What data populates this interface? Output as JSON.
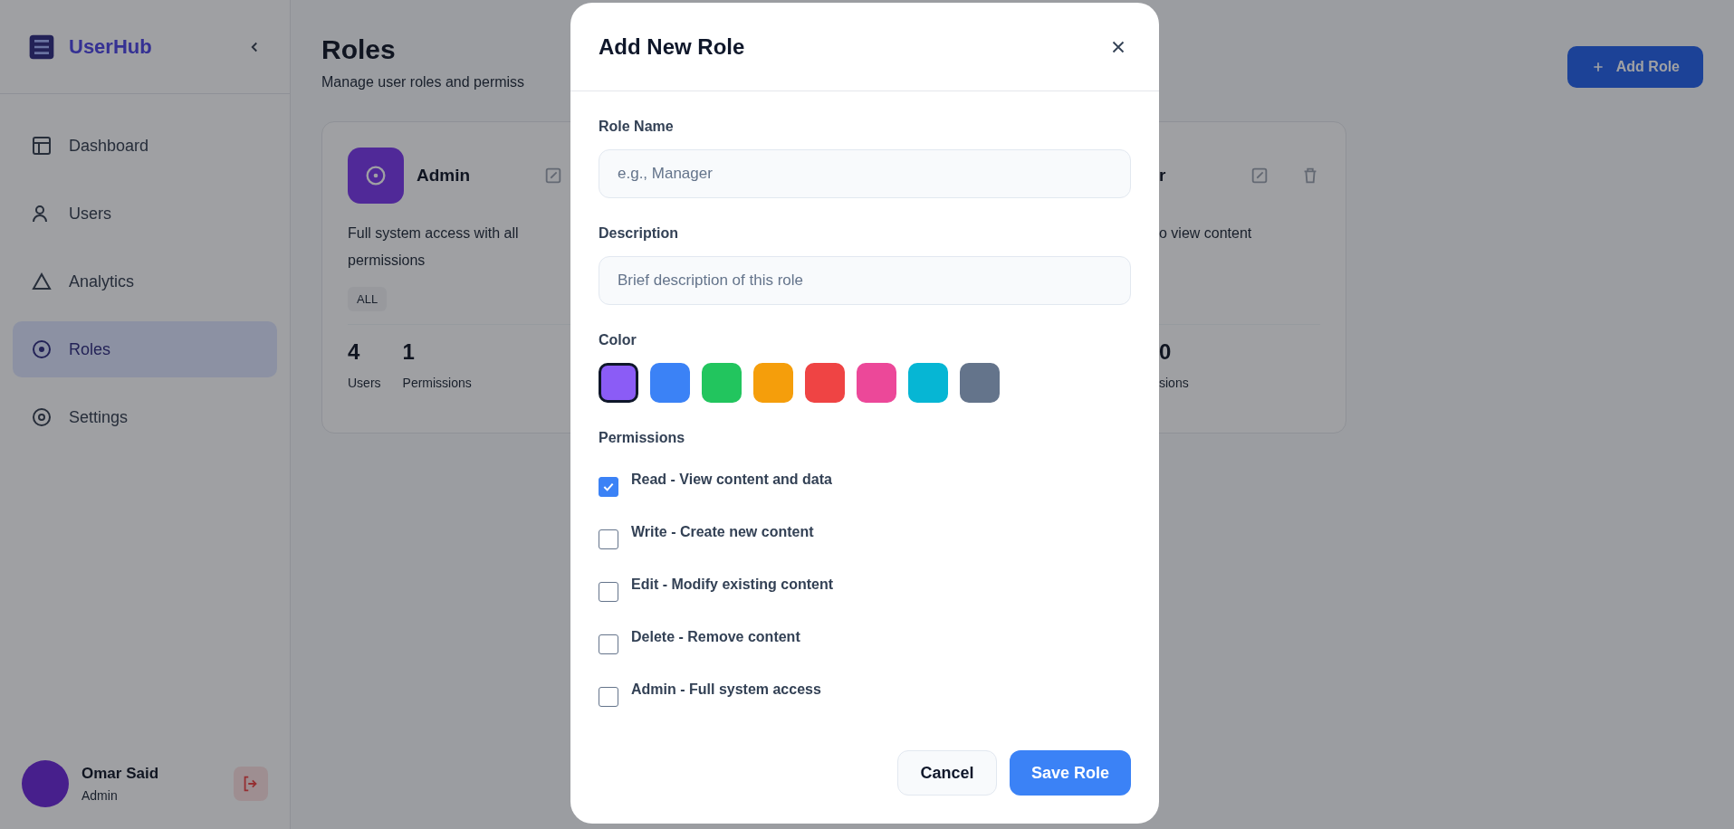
{
  "sidebar": {
    "brand": "UserHub",
    "items": [
      {
        "label": "Dashboard",
        "selected": false
      },
      {
        "label": "Users",
        "selected": false
      },
      {
        "label": "Analytics",
        "selected": false
      },
      {
        "label": "Roles",
        "selected": true
      },
      {
        "label": "Settings",
        "selected": false
      }
    ],
    "user": {
      "name": "Omar Said",
      "role": "Admin"
    }
  },
  "header": {
    "title": "Roles",
    "subtitle": "Manage user roles and permiss",
    "add_button": "Add Role"
  },
  "role_cards": [
    {
      "kind": "full",
      "title": "Admin",
      "description": "Full system access with all permissions",
      "badges": [
        "ALL"
      ],
      "stats": [
        {
          "value": "4",
          "label": "Users"
        },
        {
          "value": "1",
          "label": "Permissions"
        }
      ]
    },
    {
      "kind": "clipped",
      "title": "r",
      "description": "o view content",
      "stats": [
        {
          "value": "0",
          "label": "sions"
        }
      ]
    }
  ],
  "modal": {
    "title": "Add New Role",
    "fields": [
      {
        "label": "Role Name",
        "placeholder": "e.g., Manager"
      },
      {
        "label": "Description",
        "placeholder": "Brief description of this role"
      }
    ],
    "color": {
      "label": "Color",
      "swatches": [
        {
          "color": "#8b5cf6",
          "selected": true
        },
        {
          "color": "#3b82f6",
          "selected": false
        },
        {
          "color": "#22c55e",
          "selected": false
        },
        {
          "color": "#f59e0b",
          "selected": false
        },
        {
          "color": "#ef4444",
          "selected": false
        },
        {
          "color": "#ec4899",
          "selected": false
        },
        {
          "color": "#06b6d4",
          "selected": false
        },
        {
          "color": "#64748b",
          "selected": false
        }
      ]
    },
    "permissions": {
      "label": "Permissions",
      "items": [
        {
          "label": "Read - View content and data",
          "checked": true
        },
        {
          "label": "Write - Create new content",
          "checked": false
        },
        {
          "label": "Edit - Modify existing content",
          "checked": false
        },
        {
          "label": "Delete - Remove content",
          "checked": false
        },
        {
          "label": "Admin - Full system access",
          "checked": false
        }
      ]
    },
    "buttons": [
      {
        "label": "Cancel",
        "kind": "secondary"
      },
      {
        "label": "Save Role",
        "kind": "primary"
      }
    ]
  }
}
